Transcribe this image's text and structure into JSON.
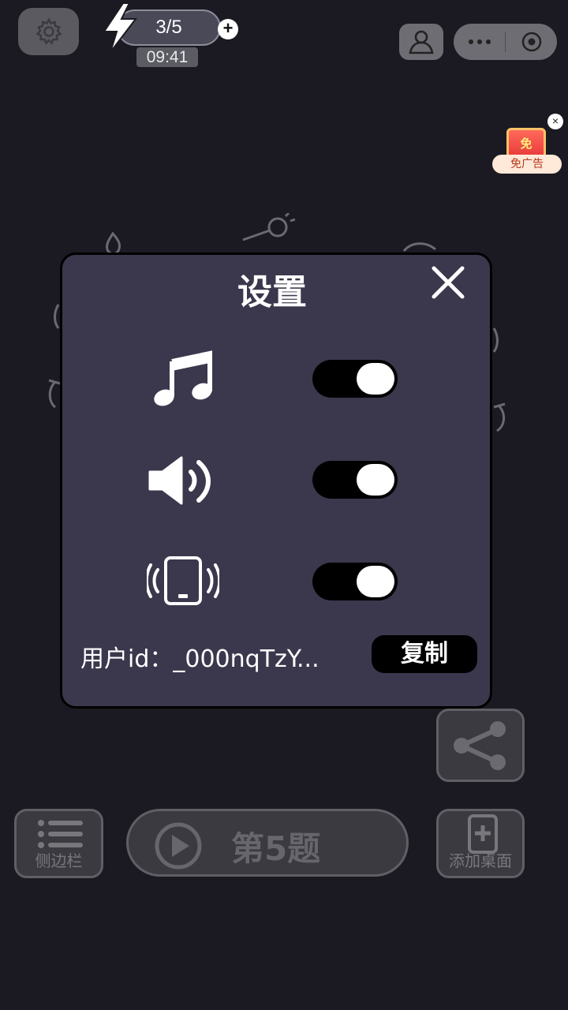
{
  "top_bar": {
    "energy_value": "3/5",
    "plus_label": "+",
    "timer": "09:41"
  },
  "no_ad": {
    "badge": "免",
    "label": "免广告",
    "close": "×"
  },
  "settings_modal": {
    "title": "设置",
    "music_enabled": true,
    "sound_enabled": true,
    "vibration_enabled": true,
    "user_id_text": "用户id：_000nqTzY...",
    "copy_label": "复制"
  },
  "bottom": {
    "sidebar_label": "侧边栏",
    "level_label": "第5题",
    "add_desktop_label": "添加桌面"
  },
  "colors": {
    "background": "#1b1a22",
    "modal_background": "#3b384d",
    "toggle_on_track": "#000000",
    "toggle_knob": "#ffffff"
  }
}
